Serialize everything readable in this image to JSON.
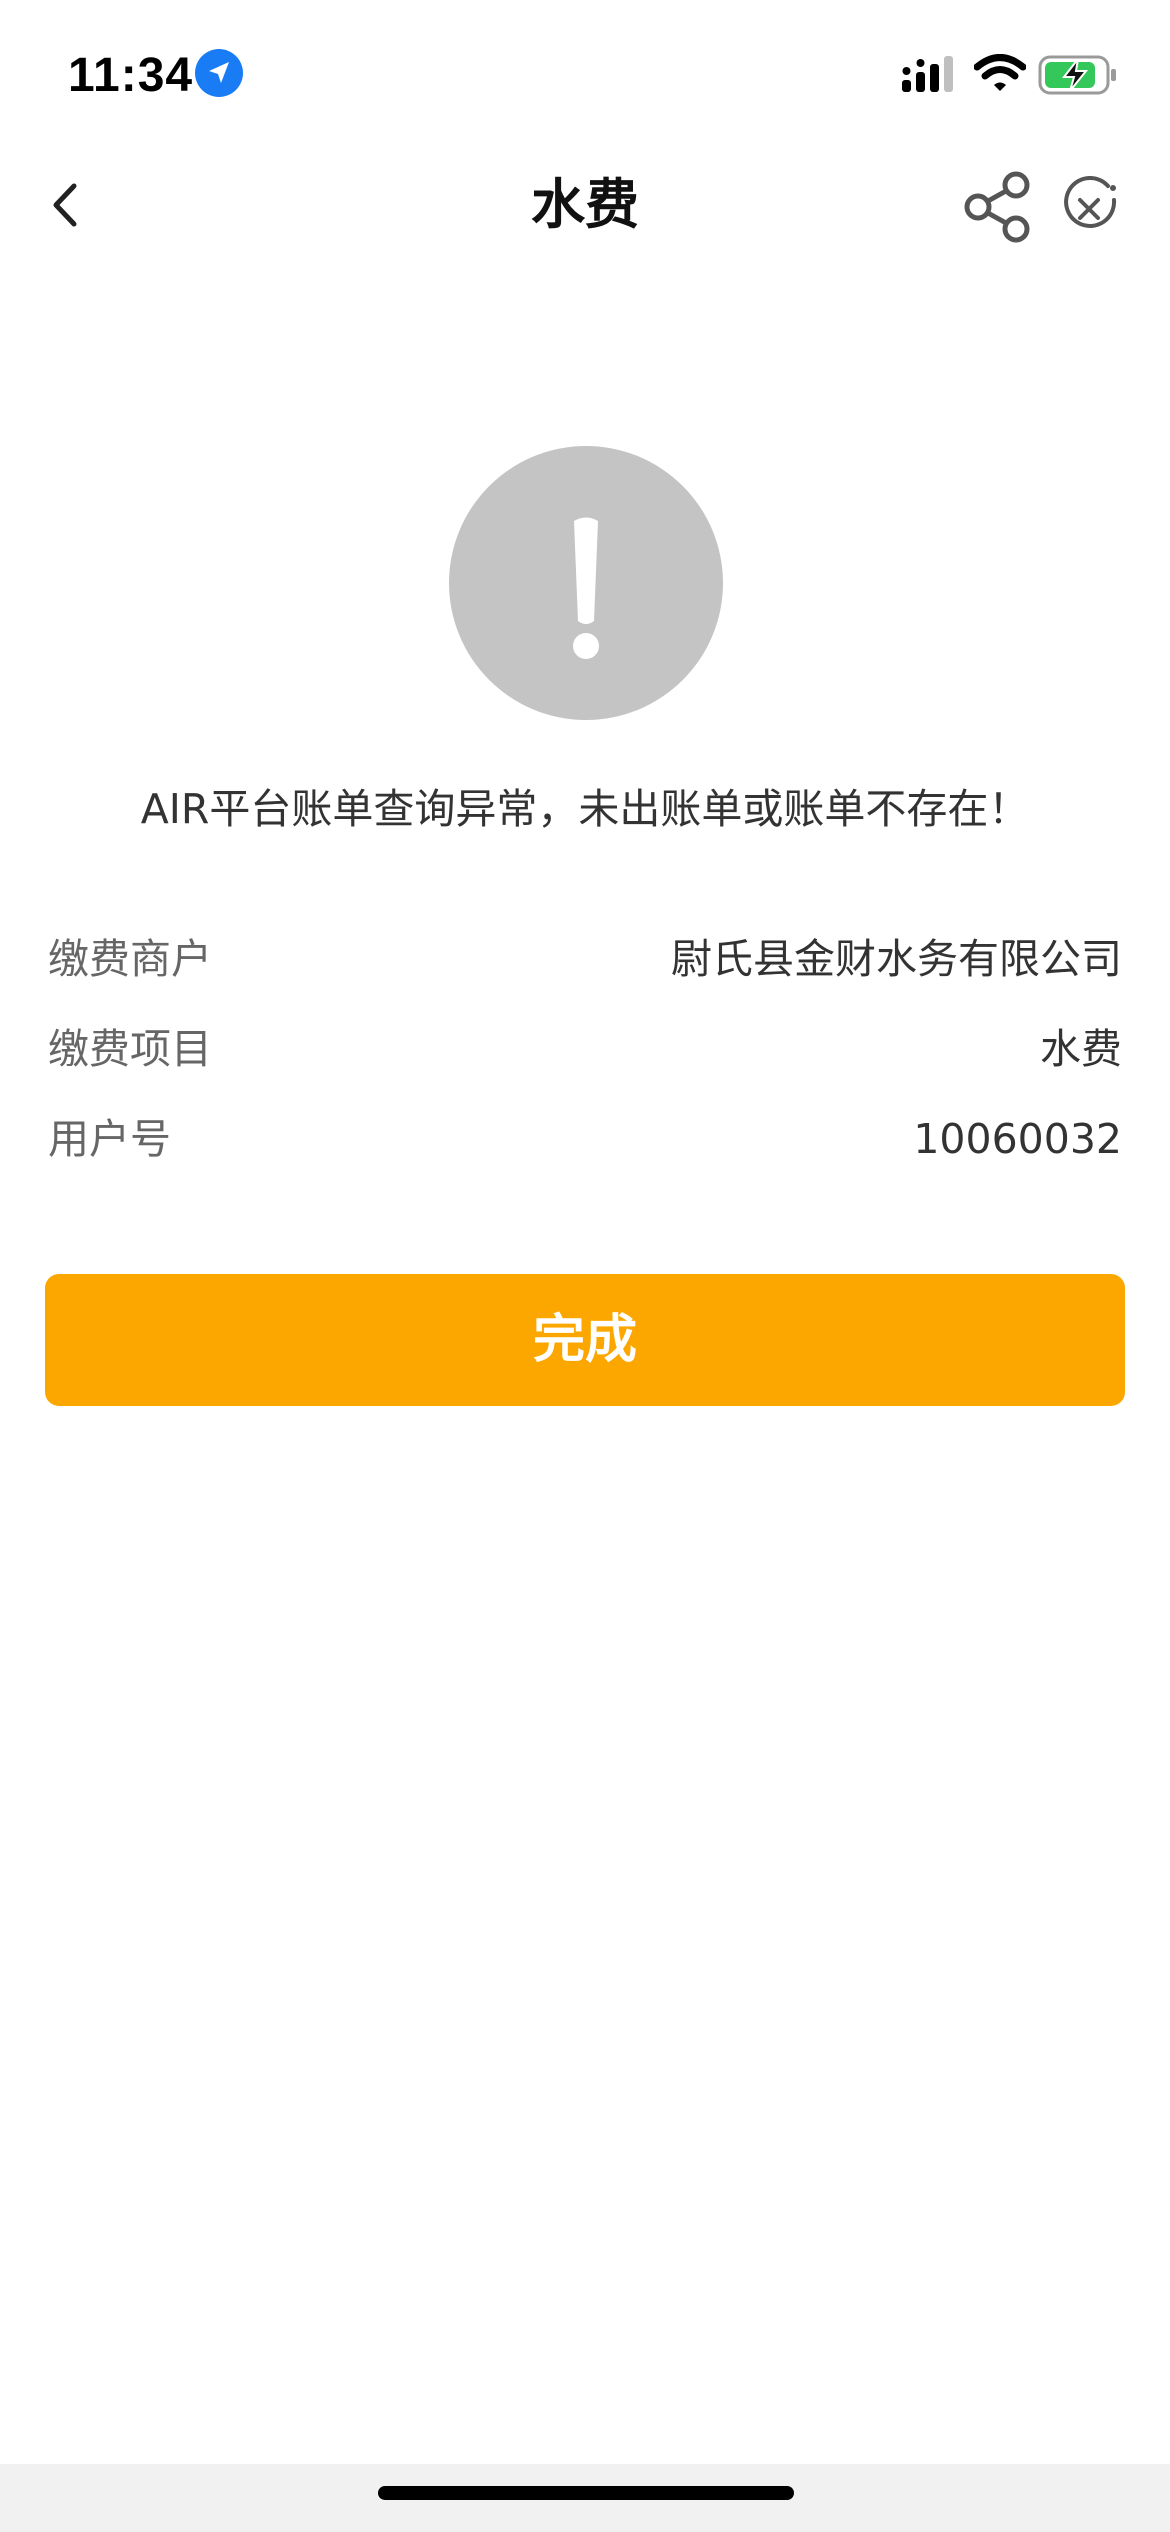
{
  "status_bar": {
    "time": "11:34",
    "icons": [
      "location-arrow-icon",
      "cellular-signal-icon",
      "wifi-icon",
      "battery-charging-icon"
    ],
    "battery_color": "#34c759",
    "location_color": "#1a7cf5"
  },
  "nav": {
    "title": "水费",
    "back_icon": "chevron-left-icon",
    "share_icon": "share-icon",
    "close_icon": "close-circle-icon"
  },
  "alert": {
    "icon": "exclamation-icon",
    "message": "AIR平台账单查询异常，未出账单或账单不存在！"
  },
  "details": [
    {
      "label": "缴费商户",
      "value": "尉氏县金财水务有限公司"
    },
    {
      "label": "缴费项目",
      "value": "水费"
    },
    {
      "label": "用户号",
      "value": "10060032"
    }
  ],
  "actions": {
    "done_label": "完成",
    "done_color": "#fca700"
  }
}
